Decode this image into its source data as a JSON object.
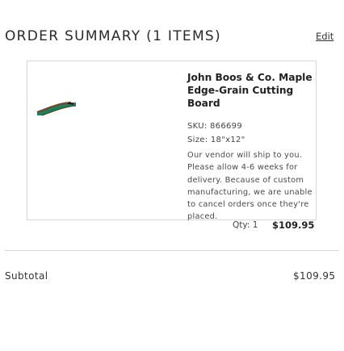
{
  "header": {
    "title": "ORDER SUMMARY (1 ITEMS)",
    "edit_label": "Edit"
  },
  "item": {
    "image_icon": "cutting-board-image",
    "name": "John Boos & Co. Maple Edge-Grain Cutting Board",
    "sku": "SKU: 866699",
    "size": "Size: 18\"x12\"",
    "note": "Our vendor will ship to you. Please allow 4-6 weeks for delivery. Because of custom manufacturing, we are unable to cancel orders once they're placed.",
    "qty": "Qty: 1",
    "price": "$109.95"
  },
  "summary": {
    "subtotal_label": "Subtotal",
    "subtotal_value": "$109.95"
  }
}
